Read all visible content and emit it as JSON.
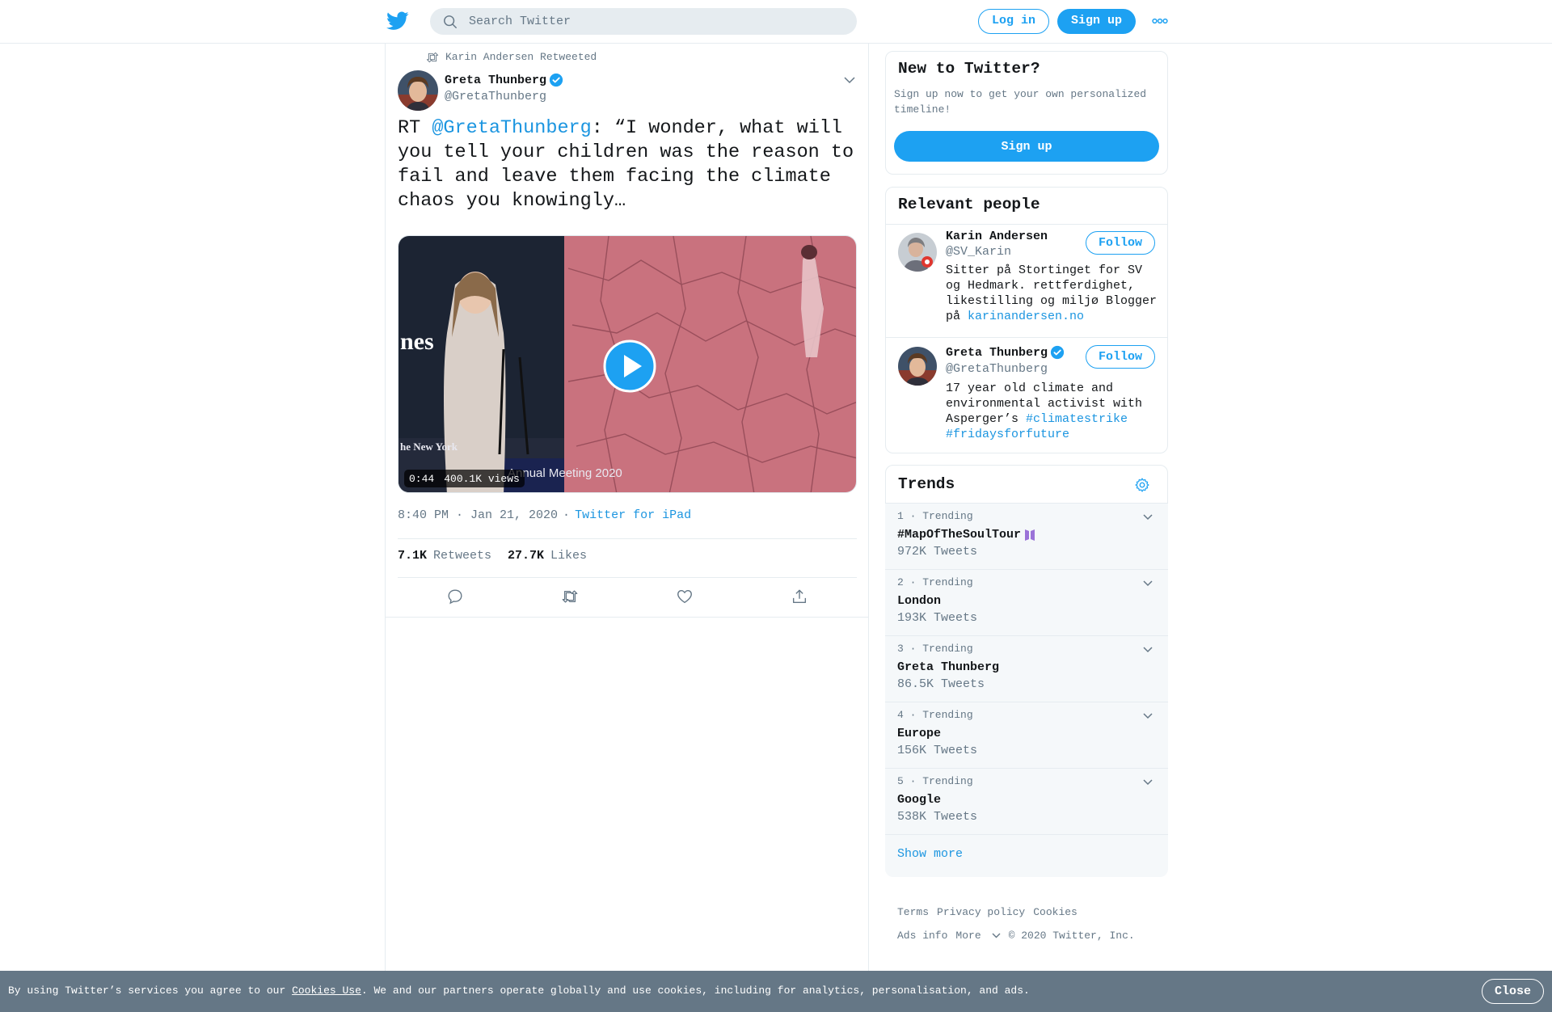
{
  "header": {
    "search_placeholder": "Search Twitter",
    "login_label": "Log in",
    "signup_label": "Sign up"
  },
  "tweet": {
    "retweeted_by": "Karin Andersen Retweeted",
    "author_name": "Greta Thunberg",
    "author_handle": "@GretaThunberg",
    "text_prefix": "RT ",
    "text_mention": "@GretaThunberg",
    "text_body": ": “I wonder, what will you tell your children was the reason to fail and leave them facing the climate chaos you knowingly…",
    "video_duration": "0:44",
    "video_views": "400.1K views",
    "time": "8:40 PM · Jan 21, 2020",
    "separator": "·",
    "source": "Twitter for iPad",
    "retweets_count": "7.1K",
    "retweets_label": "Retweets",
    "likes_count": "27.7K",
    "likes_label": "Likes"
  },
  "new_to_twitter": {
    "title": "New to Twitter?",
    "description": "Sign up now to get your own personalized timeline!",
    "signup_label": "Sign up"
  },
  "relevant_people": {
    "title": "Relevant people",
    "people": [
      {
        "name": "Karin Andersen",
        "handle": "@SV_Karin",
        "bio": "Sitter på Stortinget for SV og Hedmark. rettferdighet, likestilling og miljø Blogger på ",
        "bio_link": "karinandersen.no",
        "follow_label": "Follow"
      },
      {
        "name": "Greta Thunberg",
        "handle": "@GretaThunberg",
        "bio": "17 year old climate and environmental activist with Asperger’s ",
        "bio_link": "#climatestrike #fridaysforfuture",
        "follow_label": "Follow"
      }
    ]
  },
  "trends": {
    "title": "Trends",
    "items": [
      {
        "rank": "1 · Trending",
        "name": "#MapOfTheSoulTour",
        "count": "972K Tweets"
      },
      {
        "rank": "2 · Trending",
        "name": "London",
        "count": "193K Tweets"
      },
      {
        "rank": "3 · Trending",
        "name": "Greta Thunberg",
        "count": "86.5K Tweets"
      },
      {
        "rank": "4 · Trending",
        "name": "Europe",
        "count": "156K Tweets"
      },
      {
        "rank": "5 · Trending",
        "name": "Google",
        "count": "538K Tweets"
      }
    ],
    "show_more": "Show more"
  },
  "footer": {
    "terms": "Terms",
    "privacy": "Privacy policy",
    "cookies": "Cookies",
    "ads_info": "Ads info",
    "more": "More",
    "copyright": "© 2020 Twitter, Inc."
  },
  "cookie_bar": {
    "text_before": "By using Twitter’s services you agree to our ",
    "link": "Cookies Use",
    "text_after": ". We and our partners operate globally and use cookies, including for analytics, personalisation, and ads.",
    "close_label": "Close"
  },
  "colors": {
    "brand": "#1da1f2",
    "link": "#1b95e0",
    "muted": "#657786",
    "border": "#e6ecf0",
    "cookie_bar": "#657786"
  },
  "icons": [
    "twitter-logo-icon",
    "search-icon",
    "more-dots-icon",
    "retweet-icon",
    "verified-badge-icon",
    "chevron-down-icon",
    "play-icon",
    "reply-icon",
    "like-icon",
    "share-icon",
    "gear-icon",
    "bts-emoji-icon"
  ]
}
